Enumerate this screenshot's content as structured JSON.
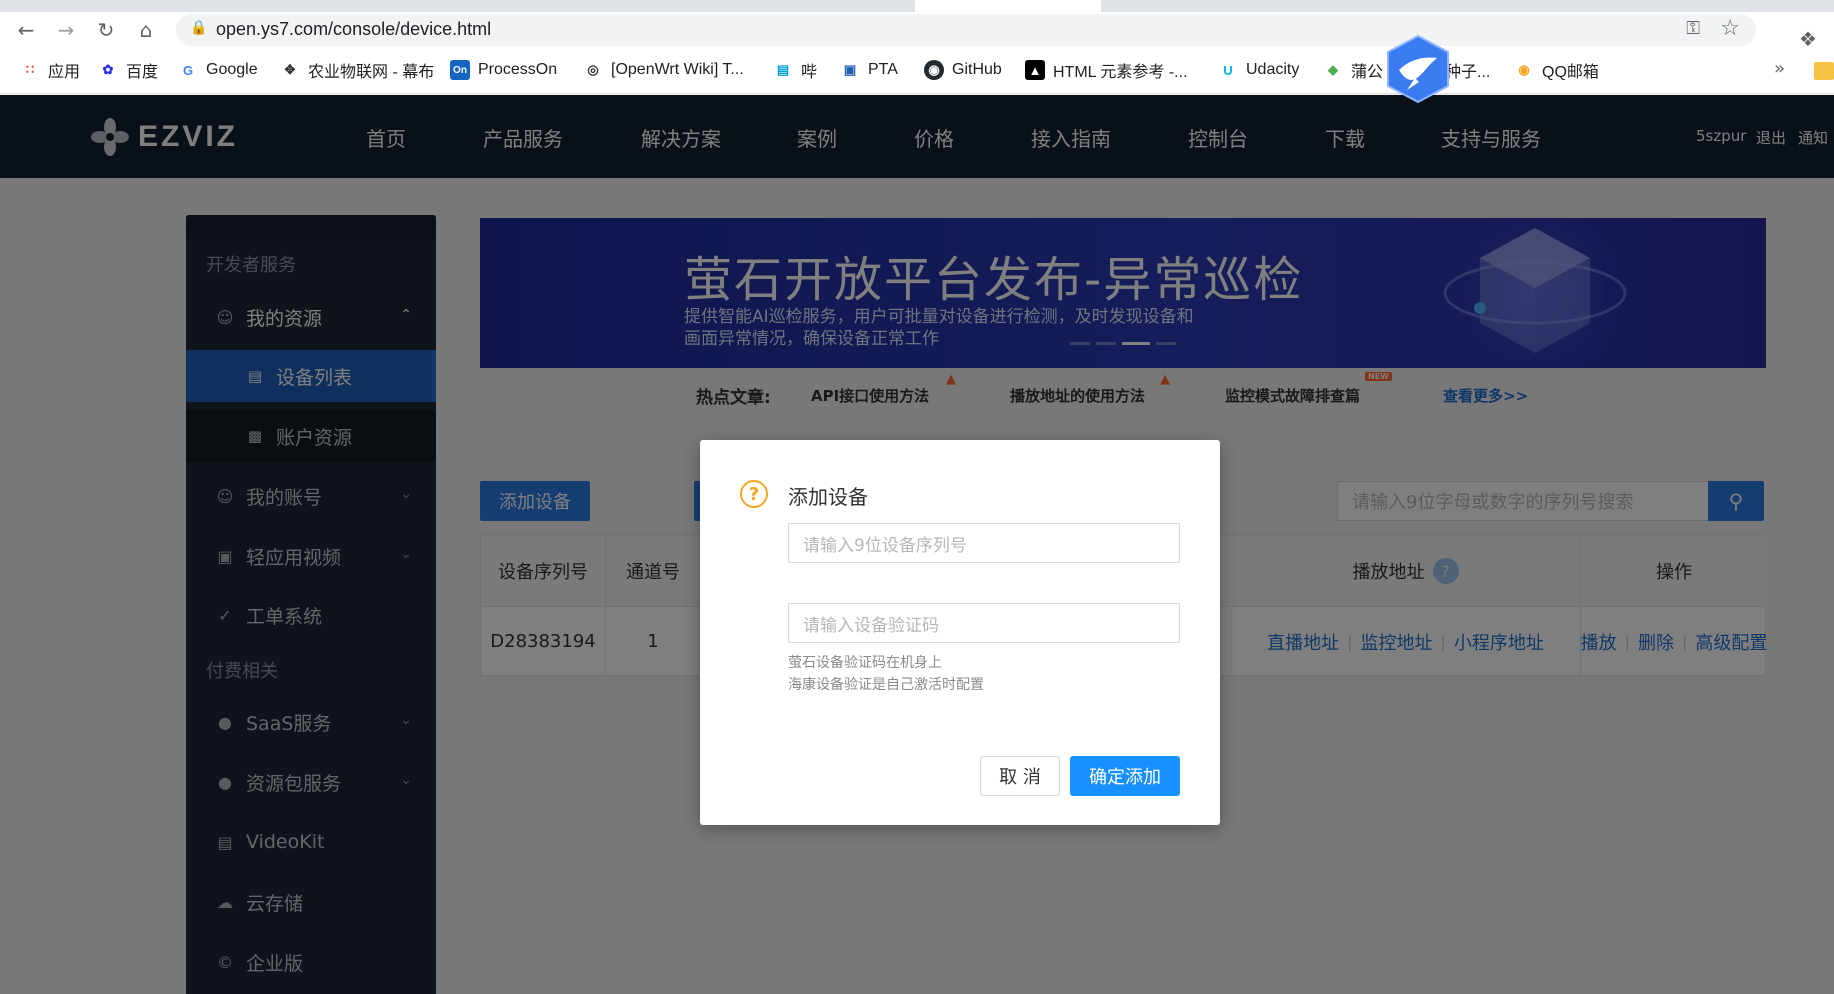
{
  "browser": {
    "url": "open.ys7.com/console/device.html",
    "bookmarks": [
      {
        "label": "应用",
        "icon": "apps-grid-icon",
        "color": "#e94235"
      },
      {
        "label": "百度",
        "icon": "baidu-paw-icon",
        "color": "#2932e1"
      },
      {
        "label": "Google",
        "icon": "google-g-icon",
        "color": "#4285f4"
      },
      {
        "label": "农业物联网 - 幕布",
        "icon": "mubu-icon",
        "color": "#333333"
      },
      {
        "label": "ProcessOn",
        "icon": "processon-icon",
        "color": "#1565c0"
      },
      {
        "label": "[OpenWrt Wiki] T...",
        "icon": "openwrt-icon",
        "color": "#333333"
      },
      {
        "label": "哔",
        "icon": "bilibili-icon",
        "color": "#00a1d6"
      },
      {
        "label": "PTA",
        "icon": "pta-icon",
        "color": "#1e5fb3"
      },
      {
        "label": "GitHub",
        "icon": "github-icon",
        "color": "#24292e"
      },
      {
        "label": "HTML 元素参考 -...",
        "icon": "mdn-icon",
        "color": "#000000"
      },
      {
        "label": "Udacity",
        "icon": "udacity-icon",
        "color": "#02b3e4"
      },
      {
        "label": "蒲公",
        "icon": "pugong-icon",
        "color": "#4caf50"
      },
      {
        "label": "种子...",
        "icon": "seed-icon",
        "color": "#666666"
      },
      {
        "label": "QQ邮箱",
        "icon": "qq-mail-icon",
        "color": "#f5a623"
      }
    ],
    "more": "»"
  },
  "site_nav": {
    "logo": "EZVIZ",
    "items": [
      "首页",
      "产品服务",
      "解决方案",
      "案例",
      "价格",
      "接入指南",
      "控制台",
      "下载",
      "支持与服务"
    ],
    "user": "5szpur",
    "logout": "退出",
    "notify": "通知"
  },
  "sidebar": {
    "section_dev": "开发者服务",
    "my_resources": "我的资源",
    "device_list": "设备列表",
    "account_resources": "账户资源",
    "my_account": "我的账号",
    "light_video": "轻应用视频",
    "ticket_system": "工单系统",
    "section_paid": "付费相关",
    "saas": "SaaS服务",
    "resource_pack": "资源包服务",
    "videokit": "VideoKit",
    "cloud_storage": "云存储",
    "enterprise": "企业版"
  },
  "banner": {
    "title": "萤石开放平台发布-异常巡检",
    "desc_line1": "提供智能AI巡检服务，用户可批量对设备进行检测，及时发现设备和",
    "desc_line2": "画面异常情况，确保设备正常工作"
  },
  "hot": {
    "label": "热点文章:",
    "links": [
      "API接口使用方法",
      "播放地址的使用方法",
      "监控模式故障排查篇"
    ],
    "new_tag": "NEW",
    "more": "查看更多>>"
  },
  "toolbar": {
    "add_device": "添加设备",
    "search_placeholder": "请输入9位字母或数字的序列号搜索"
  },
  "table": {
    "headers": {
      "serial": "设备序列号",
      "channel": "通道号",
      "play_addr": "播放地址",
      "ops": "操作"
    },
    "row": {
      "serial": "D28383194",
      "channel": "1",
      "live": "直播地址",
      "monitor": "监控地址",
      "miniapp": "小程序地址",
      "play": "播放",
      "delete": "删除",
      "advanced": "高级配置"
    }
  },
  "modal": {
    "title": "添加设备",
    "serial_placeholder": "请输入9位设备序列号",
    "code_placeholder": "请输入设备验证码",
    "hint1": "萤石设备验证码在机身上",
    "hint2": "海康设备验证是自己激活时配置",
    "cancel": "取 消",
    "confirm": "确定添加"
  },
  "colors": {
    "nav_bg": "#142030",
    "sidebar_bg": "#1d2935",
    "primary": "#2c7be5",
    "modal_primary": "#1890ff",
    "warning": "#f5a623"
  }
}
